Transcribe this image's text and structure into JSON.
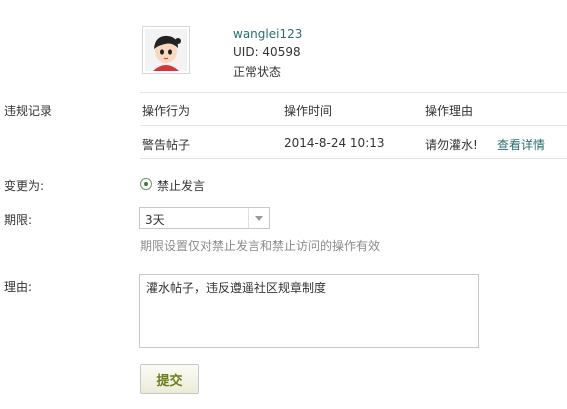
{
  "user": {
    "username": "wanglei123",
    "uid": "UID: 40598",
    "status": "正常状态"
  },
  "labels": {
    "violations": "违规记录",
    "change_to": "变更为:",
    "period": "期限:",
    "reason": "理由:"
  },
  "violations_table": {
    "headers": [
      "操作行为",
      "操作时间",
      "操作理由"
    ],
    "rows": [
      {
        "action": "警告帖子",
        "time": "2014-8-24 10:13",
        "reason": "请勿灌水!",
        "link": "查看详情"
      }
    ]
  },
  "change": {
    "option_label": "禁止发言",
    "selected": true
  },
  "period": {
    "selected": "3天",
    "hint": "期限设置仅对禁止发言和禁止访问的操作有效"
  },
  "reason": {
    "value": "灌水帖子，违反遵遥社区规章制度"
  },
  "submit_label": "提交",
  "icons": {
    "avatar": "user-avatar-cartoon",
    "dropdown": "chevron-down-icon",
    "radio": "radio-selected-icon"
  }
}
